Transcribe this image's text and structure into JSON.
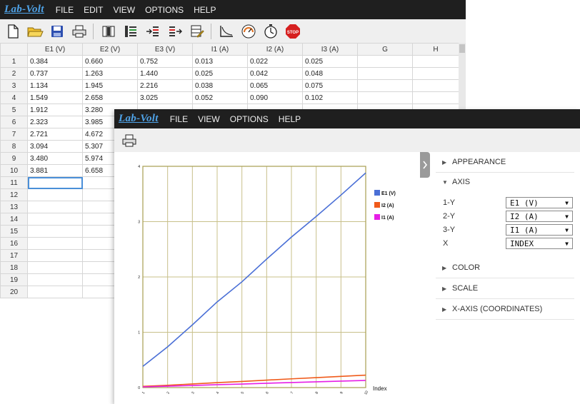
{
  "app": {
    "logo": "Lab-Volt"
  },
  "back_window": {
    "menu": [
      "FILE",
      "EDIT",
      "VIEW",
      "OPTIONS",
      "HELP"
    ],
    "toolbar_icons": [
      "new-file-icon",
      "open-folder-icon",
      "save-icon",
      "print-icon",
      "table-columns-icon",
      "tree-list-icon",
      "insert-rows-icon",
      "export-rows-icon",
      "edit-table-icon",
      "graph-icon",
      "meter-icon",
      "timer-icon",
      "stop-icon"
    ],
    "table": {
      "columns": [
        "E1 (V)",
        "E2 (V)",
        "E3 (V)",
        "I1 (A)",
        "I2 (A)",
        "I3 (A)",
        "G",
        "H"
      ],
      "rows": [
        [
          "0.384",
          "0.660",
          "0.752",
          "0.013",
          "0.022",
          "0.025",
          "",
          ""
        ],
        [
          "0.737",
          "1.263",
          "1.440",
          "0.025",
          "0.042",
          "0.048",
          "",
          ""
        ],
        [
          "1.134",
          "1.945",
          "2.216",
          "0.038",
          "0.065",
          "0.075",
          "",
          ""
        ],
        [
          "1.549",
          "2.658",
          "3.025",
          "0.052",
          "0.090",
          "0.102",
          "",
          ""
        ],
        [
          "1.912",
          "3.280",
          "",
          "",
          "",
          "",
          "",
          ""
        ],
        [
          "2.323",
          "3.985",
          "",
          "",
          "",
          "",
          "",
          ""
        ],
        [
          "2.721",
          "4.672",
          "",
          "",
          "",
          "",
          "",
          ""
        ],
        [
          "3.094",
          "5.307",
          "",
          "",
          "",
          "",
          "",
          ""
        ],
        [
          "3.480",
          "5.974",
          "",
          "",
          "",
          "",
          "",
          ""
        ],
        [
          "3.881",
          "6.658",
          "",
          "",
          "",
          "",
          "",
          ""
        ],
        [
          "",
          "",
          "",
          "",
          "",
          "",
          "",
          ""
        ],
        [
          "",
          "",
          "",
          "",
          "",
          "",
          "",
          ""
        ],
        [
          "",
          "",
          "",
          "",
          "",
          "",
          "",
          ""
        ],
        [
          "",
          "",
          "",
          "",
          "",
          "",
          "",
          ""
        ],
        [
          "",
          "",
          "",
          "",
          "",
          "",
          "",
          ""
        ],
        [
          "",
          "",
          "",
          "",
          "",
          "",
          "",
          ""
        ],
        [
          "",
          "",
          "",
          "",
          "",
          "",
          "",
          ""
        ],
        [
          "",
          "",
          "",
          "",
          "",
          "",
          "",
          ""
        ],
        [
          "",
          "",
          "",
          "",
          "",
          "",
          "",
          ""
        ],
        [
          "",
          "",
          "",
          "",
          "",
          "",
          "",
          ""
        ]
      ],
      "row_numbers": [
        "1",
        "2",
        "3",
        "4",
        "5",
        "6",
        "7",
        "8",
        "9",
        "10",
        "11",
        "12",
        "13",
        "14",
        "15",
        "16",
        "17",
        "18",
        "19",
        "20"
      ],
      "selected_row": 11
    }
  },
  "front_window": {
    "menu": [
      "FILE",
      "VIEW",
      "OPTIONS",
      "HELP"
    ],
    "toolbar_icons": [
      "print-icon"
    ],
    "panel": {
      "sections": {
        "appearance": "APPEARANCE",
        "axis": "AXIS",
        "color": "COLOR",
        "scale": "SCALE",
        "xaxis": "X-AXIS (COORDINATES)"
      },
      "axis_rows": [
        {
          "label": "1-Y",
          "value": "E1 (V)"
        },
        {
          "label": "2-Y",
          "value": "I2 (A)"
        },
        {
          "label": "3-Y",
          "value": "I1 (A)"
        },
        {
          "label": "X",
          "value": "INDEX"
        }
      ]
    }
  },
  "chart_data": {
    "type": "line",
    "x": [
      1,
      2,
      3,
      4,
      5,
      6,
      7,
      8,
      9,
      10
    ],
    "x_tick_labels": [
      "1",
      "2",
      "3",
      "4",
      "5",
      "6",
      "7",
      "8",
      "9",
      "10"
    ],
    "xlabel": "Index",
    "ylim": [
      0,
      4
    ],
    "y_ticks": [
      0,
      1,
      2,
      3,
      4
    ],
    "grid": true,
    "legend_position": "right",
    "series": [
      {
        "name": "E1 (V)",
        "color": "#4a6fd6",
        "values": [
          0.384,
          0.737,
          1.134,
          1.549,
          1.912,
          2.323,
          2.721,
          3.094,
          3.48,
          3.881
        ]
      },
      {
        "name": "I2 (A)",
        "color": "#f05a1a",
        "values": [
          0.022,
          0.042,
          0.065,
          0.09,
          0.111,
          0.135,
          0.158,
          0.18,
          0.202,
          0.225
        ]
      },
      {
        "name": "I1 (A)",
        "color": "#e61ee6",
        "values": [
          0.013,
          0.025,
          0.038,
          0.052,
          0.064,
          0.078,
          0.091,
          0.104,
          0.117,
          0.13
        ]
      }
    ],
    "colors": {
      "grid": "#c8c08a",
      "frame": "#a89e50"
    }
  }
}
